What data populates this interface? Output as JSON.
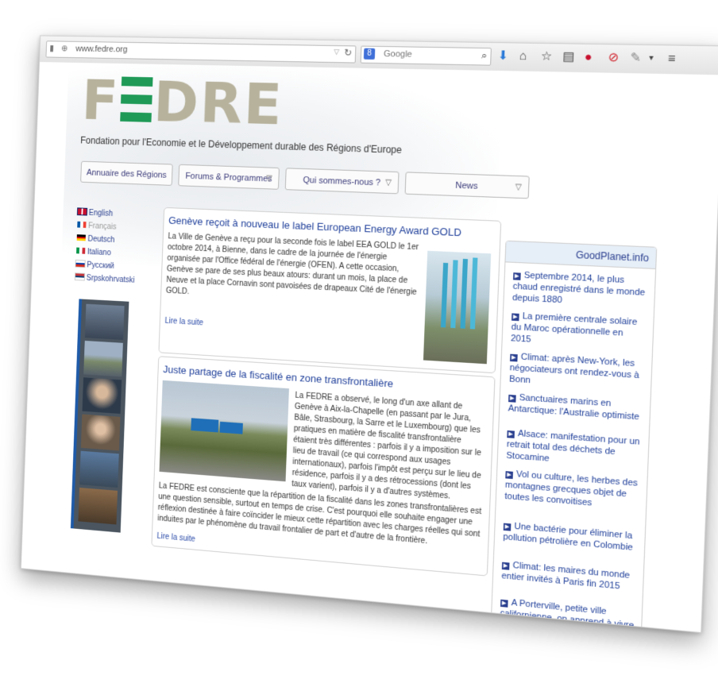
{
  "browser": {
    "url": "www.fedre.org",
    "search_placeholder": "Google"
  },
  "site": {
    "logo_text_left": "F",
    "logo_text_right": "DRE",
    "tagline": "Fondation pour l'Economie et le Développement durable des Régions d'Europe"
  },
  "nav": [
    {
      "label": "Annuaire des Régions"
    },
    {
      "label": "Forums & Programmes"
    },
    {
      "label": "Qui sommes-nous ?"
    },
    {
      "label": "News"
    }
  ],
  "languages": [
    {
      "label": "English",
      "color": "#2a3f8f"
    },
    {
      "label": "Français",
      "color": "#999999"
    },
    {
      "label": "Deutsch",
      "color": "#2a3f8f"
    },
    {
      "label": "Italiano",
      "color": "#2a3f8f"
    },
    {
      "label": "Русский",
      "color": "#2a3f8f"
    },
    {
      "label": "Srpskohrvatski",
      "color": "#2a3f8f"
    }
  ],
  "articles": [
    {
      "title": "Genève reçoit à nouveau le label European Energy Award GOLD",
      "body": "La Ville de Genève a reçu pour la seconde fois le label EEA GOLD le 1er octobre 2014, à Bienne, dans le cadre de la journée de l'énergie organisée par l'Office fédéral de l'énergie (OFEN). A cette occasion, Genève se pare de ses plus beaux atours: durant un mois, la place de Neuve et la place Cornavin sont pavoisées de drapeaux Cité de l'énergie GOLD.",
      "read_more": "Lire la suite"
    },
    {
      "title": "Juste partage de la fiscalité en zone transfrontalière",
      "body_1": "La FEDRE a observé, le long d'un axe allant de Genève à Aix-la-Chapelle (en passant par le Jura, Bâle, Strasbourg, la Sarre et le Luxembourg) que les pratiques en matière de fiscalité transfrontalière étaient très différentes : parfois il y a imposition sur le lieu de travail (ce qui correspond aux usages internationaux), parfois l'impôt est perçu sur le lieu de résidence, parfois il y a des rétrocessions (dont les taux varient), parfois il y a d'autres systèmes.",
      "body_2": "La FEDRE est consciente que la répartition de la fiscalité dans les zones transfrontalières est une question sensible, surtout en temps de crise. C'est pourquoi elle souhaite engager une réflexion destinée à faire coïncider le mieux cette répartition avec les charges réelles qui sont induites par le phénomène du travail frontalier de part et d'autre de la frontière.",
      "read_more": "Lire la suite"
    }
  ],
  "goodplanet": {
    "title": "GoodPlanet.info",
    "items": [
      {
        "text": "Septembre 2014, le plus chaud enregistré dans le monde depuis 1880"
      },
      {
        "text": "La première centrale solaire du Maroc opérationnelle en 2015"
      },
      {
        "text": "Climat: après New-York, les négociateurs ont rendez-vous à Bonn"
      },
      {
        "text": "Sanctuaires marins en Antarctique: l'Australie optimiste"
      },
      {
        "text": "Alsace: manifestation pour un retrait total des déchets de Stocamine"
      },
      {
        "text": "Vol ou culture, les herbes des montagnes grecques objet de toutes les convoitises"
      },
      {
        "text": "Une bactérie pour éliminer la pollution pétrolière en Colombie"
      },
      {
        "text": "Climat: les maires du monde entier invités à Paris fin 2015"
      },
      {
        "text": "A Porterville, petite ville californienne, on apprend à vivre sans eau"
      }
    ]
  },
  "colors": {
    "logo_gray": "#b7b29c",
    "logo_green": "#1f9a57",
    "link_blue": "#1f3f9a"
  }
}
